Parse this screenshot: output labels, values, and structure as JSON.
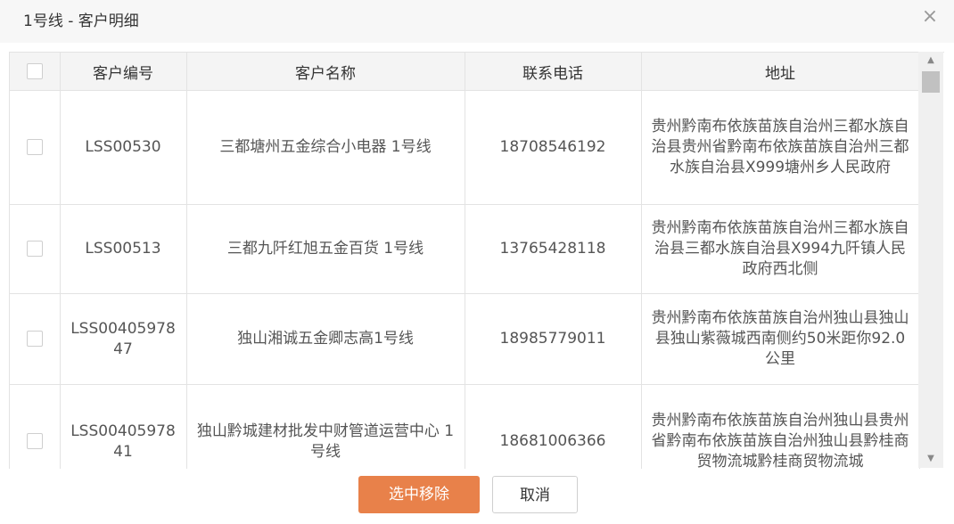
{
  "dialog": {
    "title": "1号线 - 客户明细",
    "close_glyph": "×"
  },
  "table": {
    "headers": [
      "客户编号",
      "客户名称",
      "联系电话",
      "地址"
    ],
    "rows": [
      {
        "code": "LSS00530",
        "name": "三都塘州五金综合小电器 1号线",
        "phone": "18708546192",
        "address": "贵州黔南布依族苗族自治州三都水族自治县贵州省黔南布依族苗族自治州三都水族自治县X999塘州乡人民政府"
      },
      {
        "code": "LSS00513",
        "name": "三都九阡红旭五金百货 1号线",
        "phone": "13765428118",
        "address": "贵州黔南布依族苗族自治州三都水族自治县三都水族自治县X994九阡镇人民政府西北侧"
      },
      {
        "code": "LSS0040597847",
        "name": "独山湘诚五金卿志高1号线",
        "phone": "18985779011",
        "address": "贵州黔南布依族苗族自治州独山县独山县独山紫薇城西南侧约50米距你92.0公里"
      },
      {
        "code": "LSS0040597841",
        "name": "独山黔城建材批发中财管道运营中心 1号线",
        "phone": "18681006366",
        "address": "贵州黔南布依族苗族自治州独山县贵州省黔南布依族苗族自治州独山县黔桂商贸物流城黔桂商贸物流城"
      }
    ]
  },
  "buttons": {
    "remove_label": "选中移除",
    "cancel_label": "取消"
  },
  "colors": {
    "accent": "#e8814a",
    "header_bg": "#f4f4f4"
  }
}
